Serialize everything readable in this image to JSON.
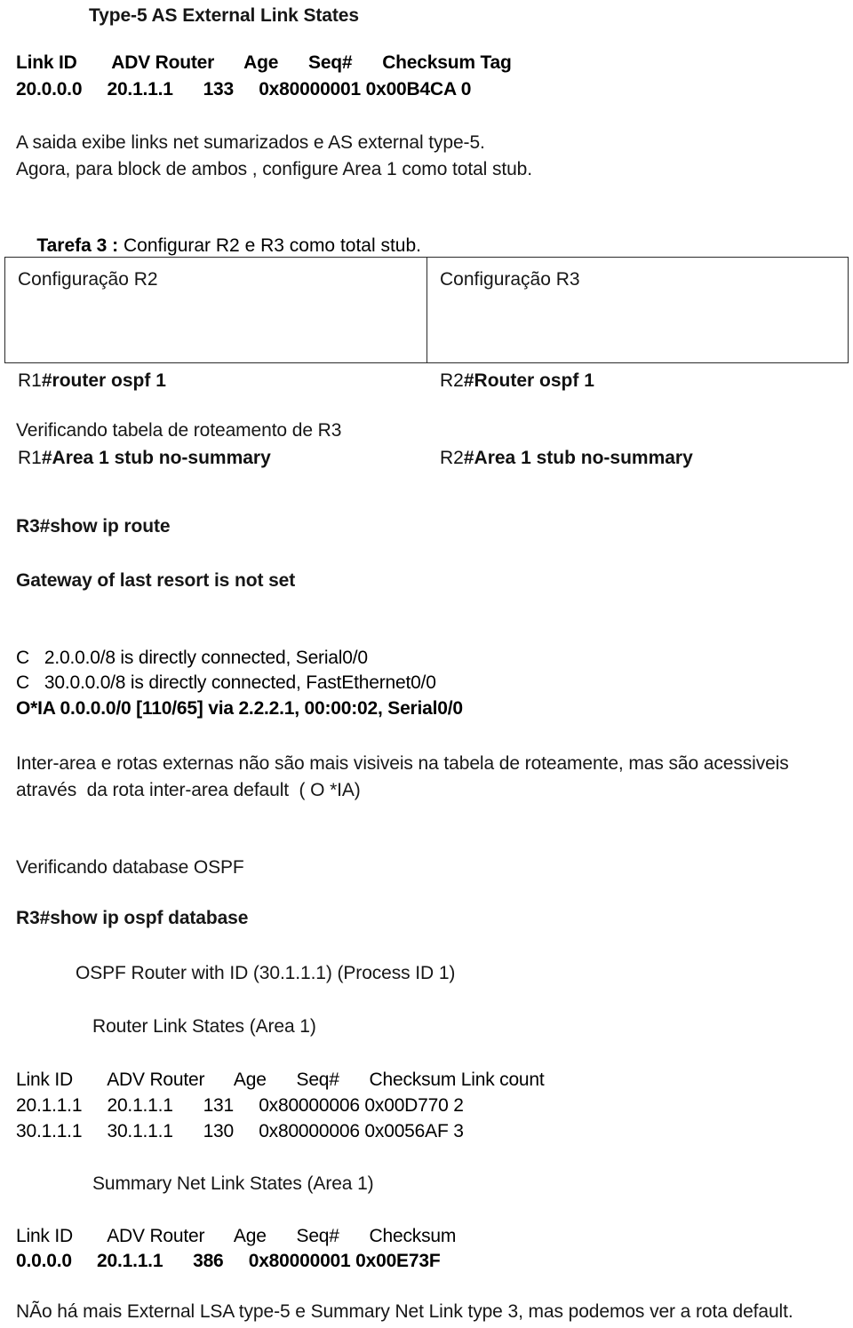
{
  "document": {
    "type": "ospf-lab-document",
    "language": "pt-BR"
  },
  "type5_section": {
    "title": "Type-5 AS External Link States",
    "table": {
      "header": "Link ID       ADV Router      Age      Seq#      Checksum Tag",
      "rows": [
        "20.0.0.0     20.1.1.1      133     0x80000001 0x00B4CA 0"
      ]
    }
  },
  "intro": {
    "line1": "A saida exibe links net sumarizados e AS external type-5.",
    "line2": "Agora, para block de ambos , configure Area 1 como total stub.",
    "task_label": "Tarefa 3 :",
    "task_text": " Configurar R2 e R3 como total stub."
  },
  "config_table": {
    "columns": [
      {
        "title": "Configuração R2",
        "prompt1": "R1",
        "command1": "#router ospf 1",
        "prompt2": "R1",
        "command2": "#Area 1 stub no-summary"
      },
      {
        "title": "Configuração R3",
        "prompt1": "R2",
        "command1": "#Router ospf 1",
        "prompt2": "R2",
        "command2": "#Area 1 stub no-summary"
      }
    ]
  },
  "route_section": {
    "heading": "Verificando tabela de roteamento de R3",
    "command": "R3#show ip route",
    "gateway": "Gateway of last resort is not set",
    "routes": [
      "C   2.0.0.0/8 is directly connected, Serial0/0",
      "C   30.0.0.0/8 is directly connected, FastEthernet0/0"
    ],
    "default_route": "O*IA 0.0.0.0/0 [110/65] via 2.2.2.1, 00:00:02, Serial0/0",
    "note_line1": "Inter-area e rotas externas não são mais visiveis na tabela de roteamente, mas são acessiveis",
    "note_line2": "através  da rota inter-area default  ( O *IA)"
  },
  "database_section": {
    "heading": "Verificando database OSPF",
    "command": "R3#show ip ospf database",
    "router_id_line": "OSPF Router with ID (30.1.1.1) (Process ID 1)",
    "router_link_states": {
      "title": "Router Link States (Area 1)",
      "header": "Link ID       ADV Router      Age      Seq#      Checksum Link count",
      "rows": [
        "20.1.1.1     20.1.1.1      131     0x80000006 0x00D770 2",
        "30.1.1.1     30.1.1.1      130     0x80000006 0x0056AF 3"
      ]
    },
    "summary_net_link_states": {
      "title": "Summary Net Link States (Area 1)",
      "header": "Link ID       ADV Router      Age      Seq#      Checksum",
      "rows": [
        "0.0.0.0     20.1.1.1      386     0x80000001 0x00E73F"
      ]
    },
    "conclusion": "NÃo há mais External LSA type-5 e Summary Net Link type 3, mas podemos ver a rota default."
  }
}
